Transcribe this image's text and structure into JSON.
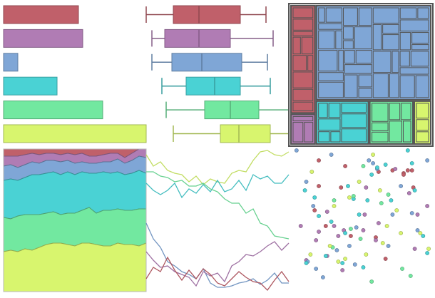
{
  "palette": {
    "red": "#c0606a",
    "purple": "#b07cb4",
    "blue": "#7fa6d6",
    "cyan": "#4ad2d4",
    "green": "#72e8a0",
    "yellow": "#d8f56e",
    "treemap_border": "#555555"
  },
  "chart_data": [
    {
      "type": "bar",
      "orientation": "horizontal",
      "categories": [
        "red",
        "purple",
        "blue",
        "cyan",
        "green",
        "yellow"
      ],
      "values": [
        105,
        111,
        20,
        75,
        139,
        200
      ],
      "xlim": [
        0,
        200
      ]
    },
    {
      "type": "boxplot",
      "orientation": "horizontal",
      "categories": [
        "red",
        "purple",
        "blue",
        "cyan",
        "green",
        "yellow"
      ],
      "boxes": [
        {
          "min": 0,
          "q1": 19,
          "median": 37,
          "q3": 66,
          "max": 84
        },
        {
          "min": 4,
          "q1": 13,
          "median": 37,
          "q3": 59,
          "max": 89
        },
        {
          "min": 4,
          "q1": 18,
          "median": 39,
          "q3": 67,
          "max": 85
        },
        {
          "min": 11,
          "q1": 28,
          "median": 48,
          "q3": 66,
          "max": 87
        },
        {
          "min": 14,
          "q1": 41,
          "median": 59,
          "q3": 79,
          "max": 100
        },
        {
          "min": 19,
          "q1": 52,
          "median": 65,
          "q3": 87,
          "max": 100
        }
      ],
      "xlim": [
        0,
        100
      ]
    },
    {
      "type": "treemap",
      "groups": [
        {
          "color": "red",
          "value": 7
        },
        {
          "color": "purple",
          "value": 2
        },
        {
          "color": "blue",
          "value": 28
        },
        {
          "color": "cyan",
          "value": 6
        },
        {
          "color": "green",
          "value": 5
        },
        {
          "color": "yellow",
          "value": 2
        }
      ]
    },
    {
      "type": "area",
      "stacked": "normalized",
      "x": [
        0,
        1,
        2,
        3,
        4,
        5,
        6,
        7,
        8,
        9,
        10,
        11,
        12,
        13,
        14,
        15,
        16,
        17,
        18,
        19,
        20
      ],
      "series": [
        {
          "color": "yellow",
          "values": [
            28,
            29,
            28,
            30,
            29,
            31,
            33,
            34,
            34,
            33,
            32,
            34,
            34,
            33,
            32,
            32,
            34,
            33,
            33,
            32,
            34
          ]
        },
        {
          "color": "green",
          "values": [
            24,
            22,
            25,
            24,
            25,
            23,
            22,
            22,
            20,
            22,
            23,
            23,
            25,
            22,
            25,
            25,
            24,
            24,
            24,
            26,
            24
          ]
        },
        {
          "color": "cyan",
          "values": [
            26,
            28,
            25,
            26,
            28,
            28,
            28,
            28,
            28,
            29,
            27,
            27,
            24,
            28,
            27,
            26,
            26,
            25,
            26,
            27,
            25
          ]
        },
        {
          "color": "blue",
          "values": [
            10,
            10,
            9,
            9,
            9,
            8,
            9,
            8,
            9,
            8,
            8,
            7,
            7,
            7,
            7,
            8,
            9,
            8,
            9,
            10,
            11
          ]
        },
        {
          "color": "purple",
          "values": [
            7,
            6,
            8,
            7,
            6,
            6,
            5,
            5,
            5,
            5,
            6,
            6,
            5,
            5,
            5,
            6,
            4,
            4,
            5,
            5,
            6
          ]
        },
        {
          "color": "red",
          "values": [
            5,
            5,
            5,
            4,
            3,
            4,
            3,
            3,
            4,
            3,
            4,
            3,
            5,
            5,
            4,
            3,
            3,
            6,
            3,
            0,
            0
          ]
        }
      ],
      "ylim": [
        0,
        100
      ]
    },
    {
      "type": "line",
      "x": [
        0,
        1,
        2,
        3,
        4,
        5,
        6,
        7,
        8,
        9,
        10,
        11,
        12,
        13,
        14,
        15,
        16,
        17,
        18,
        19,
        20
      ],
      "series": [
        {
          "color": "yellow",
          "values": [
            96,
            88,
            91,
            85,
            83,
            82,
            77,
            81,
            75,
            79,
            77,
            76,
            83,
            85,
            84,
            92,
            98,
            99,
            96,
            95,
            98
          ]
        },
        {
          "color": "cyan",
          "values": [
            76,
            71,
            68,
            71,
            76,
            66,
            72,
            69,
            75,
            70,
            78,
            70,
            72,
            78,
            71,
            82,
            79,
            81,
            76,
            76,
            82
          ]
        },
        {
          "color": "green",
          "values": [
            84,
            84,
            81,
            80,
            77,
            78,
            74,
            74,
            76,
            72,
            70,
            65,
            62,
            62,
            55,
            58,
            48,
            46,
            39,
            38,
            37
          ]
        },
        {
          "color": "blue",
          "values": [
            48,
            37,
            31,
            21,
            18,
            14,
            12,
            9,
            16,
            6,
            3,
            3,
            4,
            6,
            7,
            9,
            5,
            8,
            13,
            6,
            6
          ]
        },
        {
          "color": "purple",
          "values": [
            28,
            22,
            17,
            18,
            14,
            12,
            10,
            4,
            14,
            11,
            13,
            7,
            18,
            21,
            26,
            25,
            28,
            32,
            35,
            29,
            34
          ]
        },
        {
          "color": "red",
          "values": [
            9,
            17,
            14,
            24,
            15,
            8,
            15,
            9,
            16,
            12,
            6,
            4,
            9,
            14,
            10,
            7,
            6,
            1,
            8,
            14,
            7
          ]
        }
      ],
      "ylim": [
        0,
        100
      ]
    },
    {
      "type": "scatter",
      "xlim": [
        0,
        100
      ],
      "ylim": [
        0,
        100
      ],
      "series": [
        {
          "color": "red",
          "points": [
            [
              19,
              92
            ],
            [
              19,
              74
            ],
            [
              24,
              46
            ],
            [
              35,
              73
            ],
            [
              38,
              88
            ],
            [
              42,
              39
            ],
            [
              60,
              38
            ],
            [
              67,
              23
            ],
            [
              72,
              85
            ],
            [
              80,
              83
            ],
            [
              83,
              85
            ],
            [
              86,
              85
            ],
            [
              87,
              73
            ],
            [
              16,
              57
            ],
            [
              62,
              84
            ],
            [
              80,
              82
            ]
          ]
        },
        {
          "color": "purple",
          "points": [
            [
              6,
              46
            ],
            [
              10,
              22
            ],
            [
              17,
              36
            ],
            [
              19,
              42
            ],
            [
              25,
              56
            ],
            [
              30,
              46
            ],
            [
              33,
              39
            ],
            [
              36,
              15
            ],
            [
              37,
              43
            ],
            [
              52,
              54
            ],
            [
              53,
              73
            ],
            [
              60,
              36
            ],
            [
              62,
              48
            ],
            [
              74,
              86
            ],
            [
              84,
              69
            ],
            [
              88,
              30
            ],
            [
              90,
              54
            ],
            [
              97,
              60
            ],
            [
              25,
              25
            ],
            [
              51,
              43
            ]
          ]
        },
        {
          "color": "blue",
          "points": [
            [
              3,
              99
            ],
            [
              10,
              77
            ],
            [
              11,
              21
            ],
            [
              17,
              16
            ],
            [
              22,
              10
            ],
            [
              28,
              96
            ],
            [
              32,
              29
            ],
            [
              41,
              32
            ],
            [
              45,
              19
            ],
            [
              46,
              45
            ],
            [
              55,
              92
            ],
            [
              58,
              90
            ],
            [
              61,
              86
            ],
            [
              69,
              32
            ],
            [
              72,
              54
            ],
            [
              86,
              55
            ],
            [
              90,
              43
            ],
            [
              97,
              92
            ],
            [
              15,
              60
            ],
            [
              78,
              74
            ]
          ]
        },
        {
          "color": "cyan",
          "points": [
            [
              9,
              71
            ],
            [
              16,
              66
            ],
            [
              19,
              53
            ],
            [
              24,
              25
            ],
            [
              28,
              49
            ],
            [
              36,
              20
            ],
            [
              38,
              41
            ],
            [
              40,
              74
            ],
            [
              44,
              65
            ],
            [
              51,
              17
            ],
            [
              54,
              64
            ],
            [
              57,
              82
            ],
            [
              61,
              87
            ],
            [
              67,
              89
            ],
            [
              71,
              64
            ],
            [
              83,
              99
            ],
            [
              88,
              71
            ],
            [
              94,
              39
            ],
            [
              97,
              27
            ],
            [
              10,
              20
            ],
            [
              48,
              54
            ],
            [
              86,
              90
            ]
          ]
        },
        {
          "color": "green",
          "points": [
            [
              29,
              31
            ],
            [
              30,
              64
            ],
            [
              42,
              44
            ],
            [
              44,
              67
            ],
            [
              49,
              37
            ],
            [
              51,
              88
            ],
            [
              57,
              7
            ],
            [
              64,
              62
            ],
            [
              69,
              68
            ],
            [
              79,
              16
            ],
            [
              85,
              11
            ]
          ]
        },
        {
          "color": "yellow",
          "points": [
            [
              13,
              26
            ],
            [
              27,
              32
            ],
            [
              30,
              60
            ],
            [
              33,
              21
            ],
            [
              38,
              23
            ],
            [
              48,
              77
            ],
            [
              53,
              26
            ],
            [
              58,
              96
            ],
            [
              63,
              71
            ],
            [
              65,
              34
            ],
            [
              68,
              46
            ],
            [
              75,
              57
            ],
            [
              78,
              41
            ],
            [
              92,
              41
            ],
            [
              98,
              30
            ],
            [
              14,
              84
            ],
            [
              41,
              66
            ]
          ]
        }
      ]
    }
  ]
}
